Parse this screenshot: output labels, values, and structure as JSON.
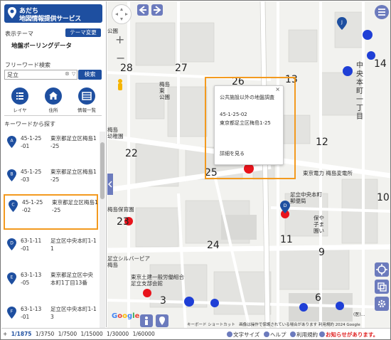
{
  "app": {
    "title_line1": "あだち",
    "title_line2": "地図情報提供サービス"
  },
  "sidebar": {
    "theme_label": "表示テーマ",
    "theme_change_button": "テーマ変更",
    "theme_name": "地盤ボーリングデータ",
    "freeword_label": "フリーワード検索",
    "search_value": "足立",
    "search_clear": "⊗",
    "search_dropdown": "▽",
    "search_button": "検索",
    "tools": [
      {
        "label": "レイヤ",
        "icon": "list-icon"
      },
      {
        "label": "住所",
        "icon": "home-icon"
      },
      {
        "label": "情報一覧",
        "icon": "table-icon"
      }
    ],
    "keyword_label": "キーワードから探す",
    "items": [
      {
        "marker": "A",
        "code": "45-1-25\n-01",
        "address": "東京都足立区梅島1\n-25"
      },
      {
        "marker": "B",
        "code": "45-1-25\n-03",
        "address": "東京都足立区梅島1\n-25"
      },
      {
        "marker": "C",
        "code": "45-1-25\n-02",
        "address": "東京都足立区梅島1\n-25"
      },
      {
        "marker": "D",
        "code": "63-1-11\n-01",
        "address": "足立区中央本町1-1\n1"
      },
      {
        "marker": "E",
        "code": "63-1-13\n-05",
        "address": "東京都足立区中央\n本町1丁目13番"
      },
      {
        "marker": "F",
        "code": "63-1-13\n-01",
        "address": "足立区中央本町1-1\n3"
      }
    ]
  },
  "map": {
    "block_numbers": [
      "28",
      "27",
      "26",
      "13",
      "14",
      "22",
      "12",
      "25",
      "10",
      "23",
      "11",
      "9",
      "24",
      "3",
      "6"
    ],
    "labels": {
      "park1": "公園",
      "umejima_park": "梅島\n東\n公園",
      "umejima_kindergarten": "梅島\n幼稚園",
      "nursery": "梅島保育園",
      "silver": "足立シルバーピア\n梅島",
      "union": "東京土建一般労働組合\n足立支部会館",
      "chuo_honmachi": "中央本町一丁目",
      "tokyo_power": "東京電力 梅島変電所",
      "post_office": "足立中央本町\n郵便局",
      "nursery2": "保や\n子ま\n園い",
      "hospital": "(医)..."
    },
    "markers": {
      "popup_marker": "C",
      "d_marker": "D",
      "j_marker": "J"
    },
    "popup": {
      "title": "公共施設以外の地盤調査",
      "code": "45-1-25-02",
      "address": "東京都足立区梅島1-25",
      "detail_link": "詳細を見る",
      "close": "×"
    },
    "attribution": "キーボード ショートカット　画像は操作で保護されている場合があります 利用規約 2024 Google",
    "google": "Google"
  },
  "footer": {
    "scales": [
      "1/1875",
      "1/3750",
      "1/7500",
      "1/15000",
      "1/30000",
      "1/60000"
    ],
    "active_scale": "1/1875",
    "plus": "+",
    "text_size": "文字サイズ",
    "help": "ヘルプ",
    "terms": "利用規約",
    "notice": "お知らせがあります。"
  },
  "colors": {
    "brand": "#1e4fa0",
    "control": "#6c7bbd",
    "highlight": "#f39a1f",
    "marker_blue": "#1f3fd6",
    "marker_red": "#e8141c"
  }
}
